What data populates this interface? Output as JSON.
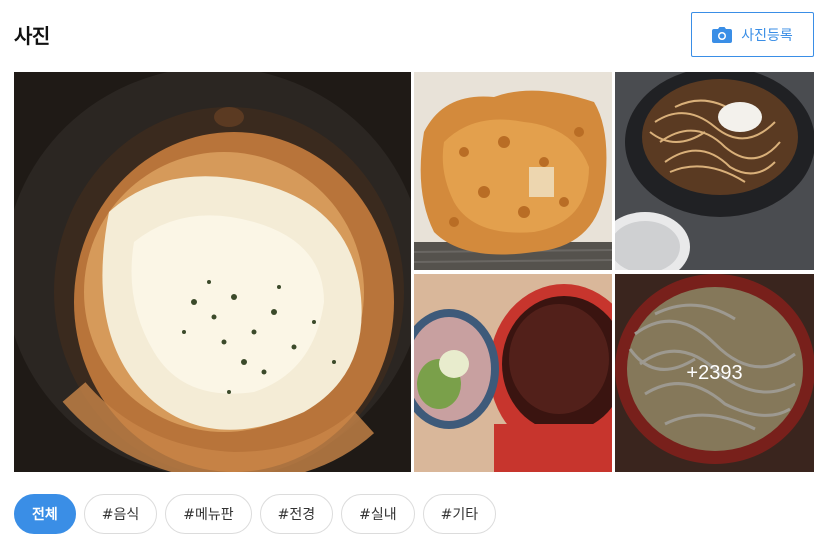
{
  "header": {
    "title": "사진",
    "upload_label": "사진등록",
    "upload_icon": "camera-icon"
  },
  "photos": {
    "more_count": "+2393"
  },
  "filters": {
    "items": [
      "전체",
      "#음식",
      "#메뉴판",
      "#전경",
      "#실내",
      "#기타"
    ],
    "active_index": 0
  },
  "colors": {
    "accent": "#3a8ee6"
  }
}
